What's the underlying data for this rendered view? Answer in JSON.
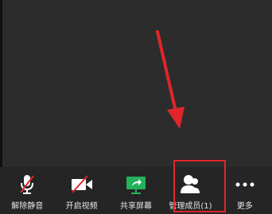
{
  "toolbar": {
    "items": [
      {
        "label": "解除静音",
        "icon": "microphone-muted-icon"
      },
      {
        "label": "开启视频",
        "icon": "video-off-icon"
      },
      {
        "label": "共享屏幕",
        "icon": "share-screen-icon"
      },
      {
        "label": "管理成员(1)",
        "icon": "participants-icon"
      },
      {
        "label": "更多",
        "icon": "more-dots-icon"
      }
    ]
  },
  "colors": {
    "highlight": "#e0262a",
    "share_green": "#22b35a",
    "mute_red": "#e0262a"
  }
}
